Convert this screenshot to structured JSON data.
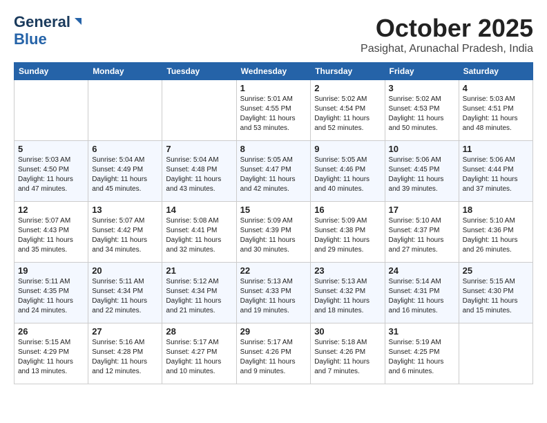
{
  "logo": {
    "line1": "General",
    "line2": "Blue"
  },
  "title": "October 2025",
  "location": "Pasighat, Arunachal Pradesh, India",
  "weekdays": [
    "Sunday",
    "Monday",
    "Tuesday",
    "Wednesday",
    "Thursday",
    "Friday",
    "Saturday"
  ],
  "weeks": [
    [
      {
        "day": "",
        "info": ""
      },
      {
        "day": "",
        "info": ""
      },
      {
        "day": "",
        "info": ""
      },
      {
        "day": "1",
        "info": "Sunrise: 5:01 AM\nSunset: 4:55 PM\nDaylight: 11 hours\nand 53 minutes."
      },
      {
        "day": "2",
        "info": "Sunrise: 5:02 AM\nSunset: 4:54 PM\nDaylight: 11 hours\nand 52 minutes."
      },
      {
        "day": "3",
        "info": "Sunrise: 5:02 AM\nSunset: 4:53 PM\nDaylight: 11 hours\nand 50 minutes."
      },
      {
        "day": "4",
        "info": "Sunrise: 5:03 AM\nSunset: 4:51 PM\nDaylight: 11 hours\nand 48 minutes."
      }
    ],
    [
      {
        "day": "5",
        "info": "Sunrise: 5:03 AM\nSunset: 4:50 PM\nDaylight: 11 hours\nand 47 minutes."
      },
      {
        "day": "6",
        "info": "Sunrise: 5:04 AM\nSunset: 4:49 PM\nDaylight: 11 hours\nand 45 minutes."
      },
      {
        "day": "7",
        "info": "Sunrise: 5:04 AM\nSunset: 4:48 PM\nDaylight: 11 hours\nand 43 minutes."
      },
      {
        "day": "8",
        "info": "Sunrise: 5:05 AM\nSunset: 4:47 PM\nDaylight: 11 hours\nand 42 minutes."
      },
      {
        "day": "9",
        "info": "Sunrise: 5:05 AM\nSunset: 4:46 PM\nDaylight: 11 hours\nand 40 minutes."
      },
      {
        "day": "10",
        "info": "Sunrise: 5:06 AM\nSunset: 4:45 PM\nDaylight: 11 hours\nand 39 minutes."
      },
      {
        "day": "11",
        "info": "Sunrise: 5:06 AM\nSunset: 4:44 PM\nDaylight: 11 hours\nand 37 minutes."
      }
    ],
    [
      {
        "day": "12",
        "info": "Sunrise: 5:07 AM\nSunset: 4:43 PM\nDaylight: 11 hours\nand 35 minutes."
      },
      {
        "day": "13",
        "info": "Sunrise: 5:07 AM\nSunset: 4:42 PM\nDaylight: 11 hours\nand 34 minutes."
      },
      {
        "day": "14",
        "info": "Sunrise: 5:08 AM\nSunset: 4:41 PM\nDaylight: 11 hours\nand 32 minutes."
      },
      {
        "day": "15",
        "info": "Sunrise: 5:09 AM\nSunset: 4:39 PM\nDaylight: 11 hours\nand 30 minutes."
      },
      {
        "day": "16",
        "info": "Sunrise: 5:09 AM\nSunset: 4:38 PM\nDaylight: 11 hours\nand 29 minutes."
      },
      {
        "day": "17",
        "info": "Sunrise: 5:10 AM\nSunset: 4:37 PM\nDaylight: 11 hours\nand 27 minutes."
      },
      {
        "day": "18",
        "info": "Sunrise: 5:10 AM\nSunset: 4:36 PM\nDaylight: 11 hours\nand 26 minutes."
      }
    ],
    [
      {
        "day": "19",
        "info": "Sunrise: 5:11 AM\nSunset: 4:35 PM\nDaylight: 11 hours\nand 24 minutes."
      },
      {
        "day": "20",
        "info": "Sunrise: 5:11 AM\nSunset: 4:34 PM\nDaylight: 11 hours\nand 22 minutes."
      },
      {
        "day": "21",
        "info": "Sunrise: 5:12 AM\nSunset: 4:34 PM\nDaylight: 11 hours\nand 21 minutes."
      },
      {
        "day": "22",
        "info": "Sunrise: 5:13 AM\nSunset: 4:33 PM\nDaylight: 11 hours\nand 19 minutes."
      },
      {
        "day": "23",
        "info": "Sunrise: 5:13 AM\nSunset: 4:32 PM\nDaylight: 11 hours\nand 18 minutes."
      },
      {
        "day": "24",
        "info": "Sunrise: 5:14 AM\nSunset: 4:31 PM\nDaylight: 11 hours\nand 16 minutes."
      },
      {
        "day": "25",
        "info": "Sunrise: 5:15 AM\nSunset: 4:30 PM\nDaylight: 11 hours\nand 15 minutes."
      }
    ],
    [
      {
        "day": "26",
        "info": "Sunrise: 5:15 AM\nSunset: 4:29 PM\nDaylight: 11 hours\nand 13 minutes."
      },
      {
        "day": "27",
        "info": "Sunrise: 5:16 AM\nSunset: 4:28 PM\nDaylight: 11 hours\nand 12 minutes."
      },
      {
        "day": "28",
        "info": "Sunrise: 5:17 AM\nSunset: 4:27 PM\nDaylight: 11 hours\nand 10 minutes."
      },
      {
        "day": "29",
        "info": "Sunrise: 5:17 AM\nSunset: 4:26 PM\nDaylight: 11 hours\nand 9 minutes."
      },
      {
        "day": "30",
        "info": "Sunrise: 5:18 AM\nSunset: 4:26 PM\nDaylight: 11 hours\nand 7 minutes."
      },
      {
        "day": "31",
        "info": "Sunrise: 5:19 AM\nSunset: 4:25 PM\nDaylight: 11 hours\nand 6 minutes."
      },
      {
        "day": "",
        "info": ""
      }
    ]
  ]
}
